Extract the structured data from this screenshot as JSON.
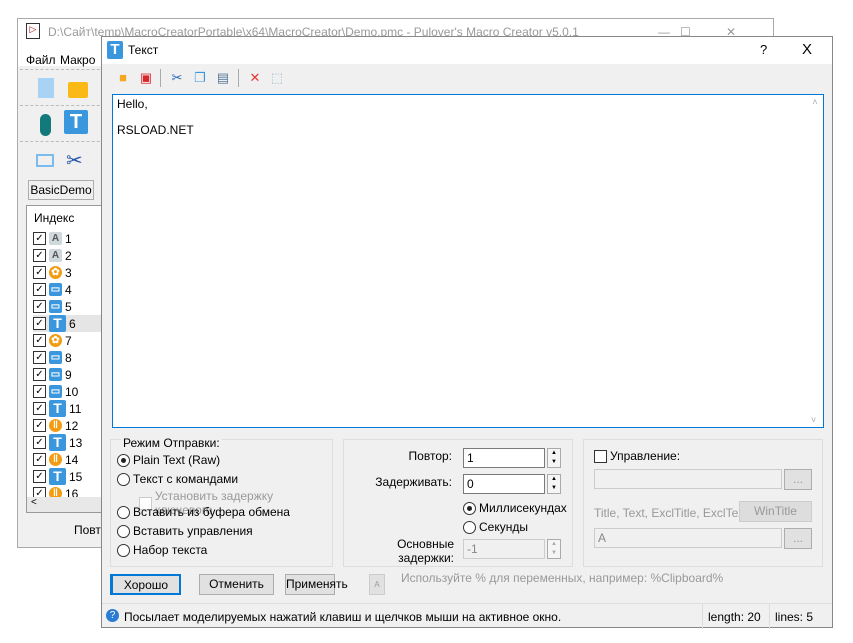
{
  "main_window": {
    "title": "D:\\Сайт\\temp\\MacroCreatorPortable\\x64\\MacroCreator\\Demo.pmc - Pulover's Macro Creator v5.0.1",
    "menu": [
      "Файл",
      "Макро"
    ],
    "tab": "BasicDemo",
    "list_header": "Индекс",
    "rows": [
      {
        "n": "1",
        "icon": "text-label-icon"
      },
      {
        "n": "2",
        "icon": "text-label-icon"
      },
      {
        "n": "3",
        "icon": "gear-icon"
      },
      {
        "n": "4",
        "icon": "window-icon"
      },
      {
        "n": "5",
        "icon": "window-icon"
      },
      {
        "n": "6",
        "icon": "text-t-icon"
      },
      {
        "n": "7",
        "icon": "gear-icon"
      },
      {
        "n": "8",
        "icon": "window-icon"
      },
      {
        "n": "9",
        "icon": "window-icon"
      },
      {
        "n": "10",
        "icon": "window-icon"
      },
      {
        "n": "11",
        "icon": "text-t-icon"
      },
      {
        "n": "12",
        "icon": "pause-icon"
      },
      {
        "n": "13",
        "icon": "text-t-icon"
      },
      {
        "n": "14",
        "icon": "pause-icon"
      },
      {
        "n": "15",
        "icon": "text-t-icon"
      },
      {
        "n": "16",
        "icon": "pause-icon"
      }
    ],
    "bottom_label": "Повто"
  },
  "dialog": {
    "title": "Текст",
    "help": "?",
    "close": "X",
    "text": "Hello,\n\nRSLOAD.NET",
    "send_mode": {
      "label": "Режим Отправки:",
      "options": [
        "Plain Text (Raw)",
        "Текст с командами",
        "Вставить из буфера обмена",
        "Вставить управления",
        "Набор текста"
      ],
      "selected": 0,
      "key_delay_label": "Установить задержку ключевого"
    },
    "repeat_label": "Повтор:",
    "repeat_value": "1",
    "delay_label": "Задерживать:",
    "delay_value": "0",
    "ms_label": "Миллисекундах",
    "sec_label": "Секунды",
    "base_delay_label": "Основные задержки:",
    "base_delay_value": "-1",
    "control_label": "Управление:",
    "control_value": "",
    "browse": "...",
    "wintitle_hint": "Title, Text, ExclTitle, ExclText",
    "wintitle_button": "WinTitle",
    "wintitle_value": "A",
    "ok": "Хорошо",
    "cancel": "Отменить",
    "apply": "Применять",
    "hint": "Используйте % для переменных, например: %Clipboard%",
    "status": "Посылает моделируемых нажатий клавиш и щелчков мыши на активное окно.",
    "length": "length: 20",
    "lines": "lines: 5"
  },
  "colors": {
    "accent": "#0078d7",
    "icon_blue": "#3a96dd",
    "icon_orange": "#f39c12"
  }
}
